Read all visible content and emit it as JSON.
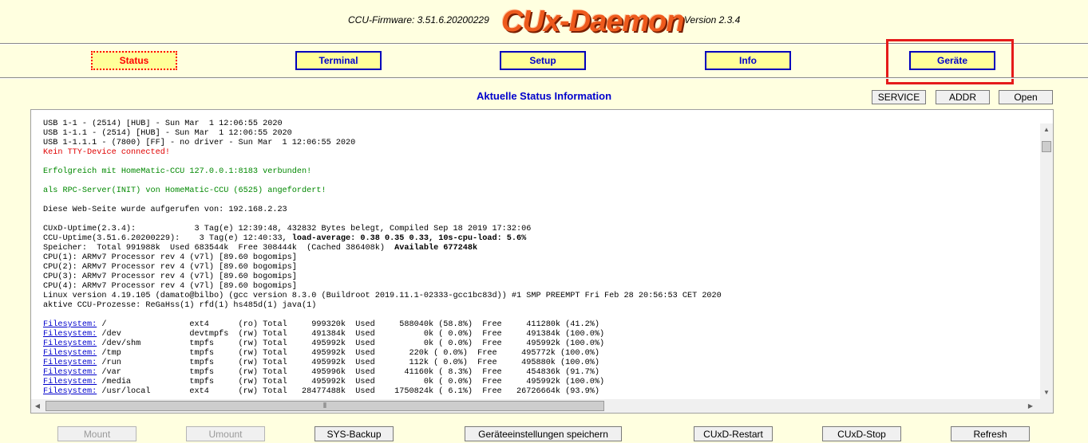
{
  "header": {
    "firmware": "CCU-Firmware: 3.51.6.20200229",
    "logo": "CUx-Daemon",
    "version": "Version 2.3.4"
  },
  "nav": [
    {
      "label": "Status",
      "active": true
    },
    {
      "label": "Terminal"
    },
    {
      "label": "Setup"
    },
    {
      "label": "Info"
    },
    {
      "label": "Geräte"
    }
  ],
  "content": {
    "title": "Aktuelle Status Information",
    "buttons": [
      "SERVICE",
      "ADDR",
      "Open"
    ]
  },
  "log": {
    "usb": [
      "USB 1-1 - (2514) [HUB] - Sun Mar  1 12:06:55 2020",
      "USB 1-1.1 - (2514) [HUB] - Sun Mar  1 12:06:55 2020",
      "USB 1-1.1.1 - (7800) [FF] - no driver - Sun Mar  1 12:06:55 2020"
    ],
    "tty_error": "Kein TTY-Device connected!",
    "connected": "Erfolgreich mit HomeMatic-CCU 127.0.0.1:8183 verbunden!",
    "rpc": "als RPC-Server(INIT) von HomeMatic-CCU (6525) angefordert!",
    "called_from": "Diese Web-Seite wurde aufgerufen von: 192.168.2.23",
    "cuxd_uptime": "CUxD-Uptime(2.3.4):            3 Tag(e) 12:39:48, 432832 Bytes belegt, Compiled Sep 18 2019 17:32:06",
    "ccu_uptime_a": "CCU-Uptime(3.51.6.20200229):    3 Tag(e) 12:40:33, ",
    "ccu_uptime_b": "load-average: 0.38 0.35 0.33, 10s-cpu-load: 5.6%",
    "speicher_a": "Speicher:  Total 991988k  Used 683544k  Free 308444k  (Cached 386408k)  ",
    "speicher_b": "Available 677248k",
    "cpus": [
      "CPU(1): ARMv7 Processor rev 4 (v7l) [89.60 bogomips]",
      "CPU(2): ARMv7 Processor rev 4 (v7l) [89.60 bogomips]",
      "CPU(3): ARMv7 Processor rev 4 (v7l) [89.60 bogomips]",
      "CPU(4): ARMv7 Processor rev 4 (v7l) [89.60 bogomips]"
    ],
    "linux": "Linux version 4.19.105 (damato@bilbo) (gcc version 8.3.0 (Buildroot 2019.11.1-02333-gcc1bc83d)) #1 SMP PREEMPT Fri Feb 28 20:56:53 CET 2020",
    "processes": "aktive CCU-Prozesse: ReGaHss(1) rfd(1) hs485d(1) java(1)",
    "fs_link": "Filesystem:",
    "filesystems": [
      " /                 ext4      (ro) Total     999320k  Used     588040k (58.8%)  Free     411280k (41.2%)",
      " /dev              devtmpfs  (rw) Total     491384k  Used          0k ( 0.0%)  Free     491384k (100.0%)",
      " /dev/shm          tmpfs     (rw) Total     495992k  Used          0k ( 0.0%)  Free     495992k (100.0%)",
      " /tmp              tmpfs     (rw) Total     495992k  Used       220k ( 0.0%)  Free     495772k (100.0%)",
      " /run              tmpfs     (rw) Total     495992k  Used       112k ( 0.0%)  Free     495880k (100.0%)",
      " /var              tmpfs     (rw) Total     495996k  Used      41160k ( 8.3%)  Free     454836k (91.7%)",
      " /media            tmpfs     (rw) Total     495992k  Used          0k ( 0.0%)  Free     495992k (100.0%)",
      " /usr/local        ext4      (rw) Total   28477488k  Used    1750824k ( 6.1%)  Free   26726664k (93.9%)"
    ]
  },
  "bottom_buttons": [
    {
      "label": "Mount",
      "disabled": true
    },
    {
      "label": "Umount",
      "disabled": true
    },
    {
      "label": "SYS-Backup"
    },
    {
      "label": "Geräteeinstellungen speichern"
    },
    {
      "label": "CUxD-Restart"
    },
    {
      "label": "CUxD-Stop"
    },
    {
      "label": "Refresh"
    }
  ]
}
